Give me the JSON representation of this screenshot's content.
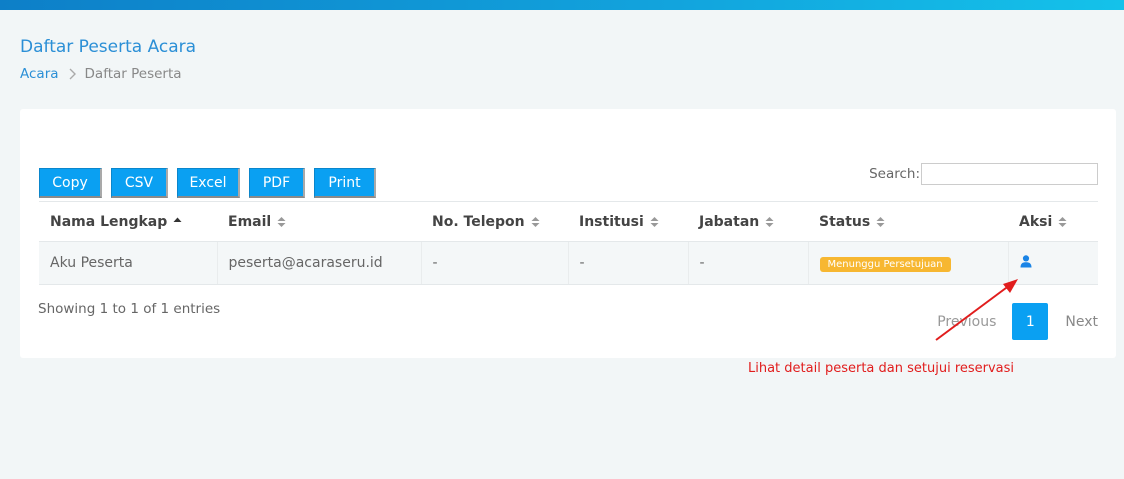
{
  "header": {
    "title": "Daftar Peserta Acara",
    "breadcrumb": {
      "link": "Acara",
      "current": "Daftar Peserta"
    }
  },
  "toolbar": {
    "buttons": [
      "Copy",
      "CSV",
      "Excel",
      "PDF",
      "Print"
    ]
  },
  "search": {
    "label": "Search:",
    "value": ""
  },
  "table": {
    "columns": [
      "Nama Lengkap",
      "Email",
      "No. Telepon",
      "Institusi",
      "Jabatan",
      "Status",
      "Aksi"
    ],
    "rows": [
      {
        "name": "Aku Peserta",
        "email": "peserta@acaraseru.id",
        "phone": "-",
        "institution": "-",
        "position": "-",
        "status": "Menunggu Persetujuan",
        "action_icon": "user-icon"
      }
    ]
  },
  "footer": {
    "info": "Showing 1 to 1 of 1 entries",
    "pagination": {
      "previous": "Previous",
      "current": "1",
      "next": "Next"
    }
  },
  "annotation": {
    "text": "Lihat detail peserta dan setujui reservasi",
    "color": "#e11d1d"
  },
  "colors": {
    "accent": "#0aa0f2",
    "title": "#2b8fd6",
    "badge": "#f7b731"
  }
}
